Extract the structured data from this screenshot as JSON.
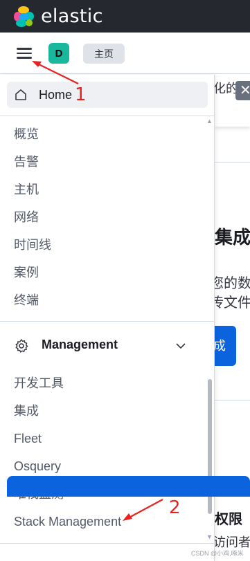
{
  "header": {
    "brand": "elastic",
    "logo_colors": [
      "#fec514",
      "#f04e98",
      "#00bfb3",
      "#1ba9f5",
      "#93c90e",
      "#0077cc"
    ]
  },
  "subbar": {
    "menu_icon": "hamburger-menu-icon",
    "space_initial": "D",
    "space_color": "#19b89c",
    "breadcrumb": "主页"
  },
  "nav": {
    "home_label": "Home",
    "security_items": [
      "概览",
      "告警",
      "主机",
      "网络",
      "时间线",
      "案例",
      "终端"
    ],
    "management": {
      "label": "Management",
      "icon": "gear-icon",
      "expanded": true,
      "items": [
        "开发工具",
        "集成",
        "Fleet",
        "Osquery",
        "堆栈监测",
        "Stack Management"
      ]
    }
  },
  "background_page": {
    "toast_text": "化的",
    "close_icon": "close-icon",
    "heading": "集成",
    "line1": "您的数",
    "line2": "传文件",
    "button_label": "成",
    "section_title": "权限",
    "section_line": "访问者不"
  },
  "annotations": {
    "label1": "1",
    "label2": "2",
    "color": "#e8231f"
  },
  "watermark": "CSDN @小鸡,啄米"
}
